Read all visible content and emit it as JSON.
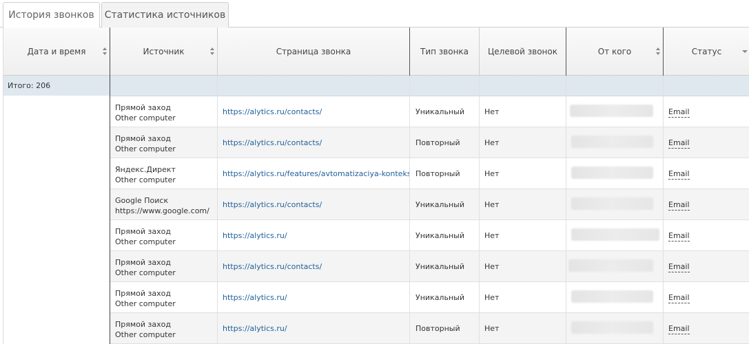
{
  "tabs": [
    {
      "label": "История звонков",
      "active": true
    },
    {
      "label": "Статистика источников",
      "active": false
    }
  ],
  "columns": {
    "datetime": "Дата и время",
    "source": "Источник",
    "page": "Страница звонка",
    "type": "Тип звонка",
    "target": "Целевой звонок",
    "from": "От кого",
    "status": "Статус"
  },
  "total": "Итого: 206",
  "rows": [
    {
      "source": "Прямой заход",
      "source_sub": "Other computer",
      "page": "https://alytics.ru/contacts/",
      "type": "Уникальный",
      "target": "Нет",
      "status": "Email"
    },
    {
      "source": "Прямой заход",
      "source_sub": "Other computer",
      "page": "https://alytics.ru/contacts/",
      "type": "Повторный",
      "target": "Нет",
      "status": "Email"
    },
    {
      "source": "Яндекс.Директ",
      "source_sub": "Other computer",
      "page": "https://alytics.ru/features/avtomatizaciya-kontekstnoj-",
      "type": "Повторный",
      "target": "Нет",
      "status": "Email"
    },
    {
      "source": "Google Поиск",
      "source_sub": "https://www.google.com/",
      "page": "https://alytics.ru/contacts/",
      "type": "Уникальный",
      "target": "Нет",
      "status": "Email"
    },
    {
      "source": "Прямой заход",
      "source_sub": "Other computer",
      "page": "https://alytics.ru/",
      "type": "Уникальный",
      "target": "Нет",
      "status": "Email"
    },
    {
      "source": "Прямой заход",
      "source_sub": "Other computer",
      "page": "https://alytics.ru/contacts/",
      "type": "Уникальный",
      "target": "Нет",
      "status": "Email"
    },
    {
      "source": "Прямой заход",
      "source_sub": "Other computer",
      "page": "https://alytics.ru/",
      "type": "Уникальный",
      "target": "Нет",
      "status": "Email"
    },
    {
      "source": "Прямой заход",
      "source_sub": "Other computer",
      "page": "https://alytics.ru/",
      "type": "Повторный",
      "target": "Нет",
      "status": "Email"
    }
  ]
}
